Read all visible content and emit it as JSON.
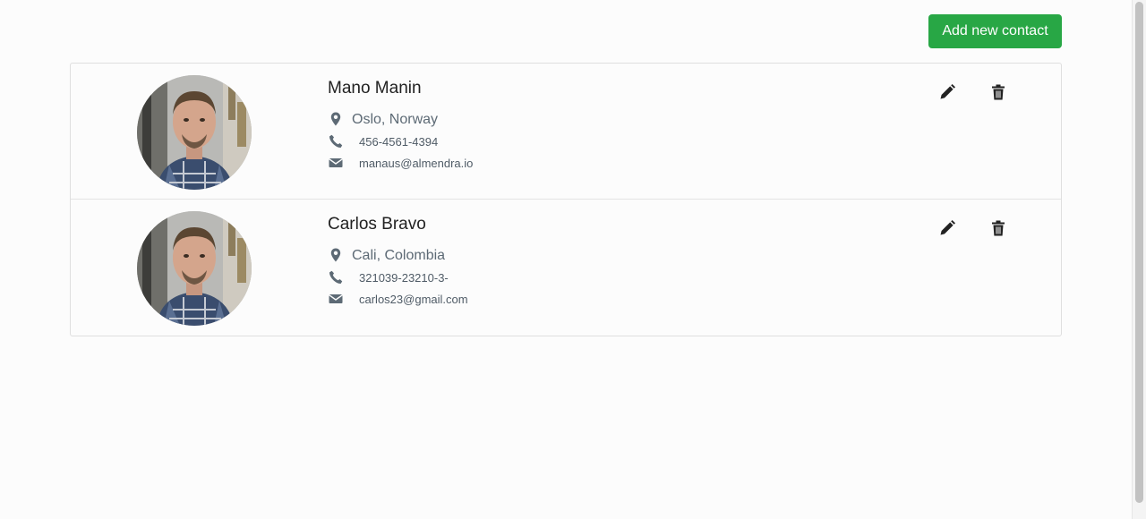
{
  "toolbar": {
    "add_label": "Add new contact",
    "add_color": "#28a745"
  },
  "contacts": [
    {
      "name": "Mano Manin",
      "location": "Oslo, Norway",
      "phone": "456-4561-4394",
      "email": "manaus@almendra.io",
      "icons": [
        "map-marker-icon",
        "phone-icon",
        "envelope-icon",
        "pencil-icon",
        "trash-icon"
      ]
    },
    {
      "name": "Carlos Bravo",
      "location": "Cali, Colombia",
      "phone": "321039-23210-3-",
      "email": "carlos23@gmail.com",
      "icons": [
        "map-marker-icon",
        "phone-icon",
        "envelope-icon",
        "pencil-icon",
        "trash-icon"
      ]
    }
  ],
  "colors": {
    "text_primary": "#222222",
    "text_secondary": "#5d6a75",
    "border": "#dfdfdf"
  }
}
